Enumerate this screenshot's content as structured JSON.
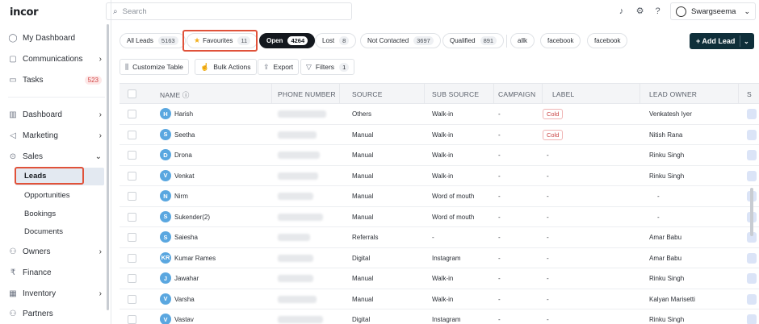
{
  "app": {
    "logo": "incor"
  },
  "search": {
    "placeholder": "Search"
  },
  "user": {
    "name": "Swargseema"
  },
  "sidebar": {
    "items": [
      {
        "label": "My Dashboard",
        "icon": "user-icon"
      },
      {
        "label": "Communications",
        "icon": "chat-icon"
      },
      {
        "label": "Tasks",
        "icon": "calendar-icon",
        "badge": "523"
      },
      {
        "label": "Dashboard",
        "icon": "bar-chart-icon"
      },
      {
        "label": "Marketing",
        "icon": "megaphone-icon"
      },
      {
        "label": "Sales",
        "icon": "dollar-icon"
      },
      {
        "label": "Owners",
        "icon": "people-icon"
      },
      {
        "label": "Finance",
        "icon": "rupee-icon"
      },
      {
        "label": "Inventory",
        "icon": "building-icon"
      },
      {
        "label": "Partners",
        "icon": "handshake-icon"
      }
    ],
    "sales_sub": [
      "Leads",
      "Opportunities",
      "Bookings",
      "Documents"
    ]
  },
  "chips": [
    {
      "label": "All Leads",
      "count": "5163"
    },
    {
      "label": "Favourites",
      "count": "11"
    },
    {
      "label": "Open",
      "count": "4264"
    },
    {
      "label": "Lost",
      "count": "8"
    },
    {
      "label": "Not Contacted",
      "count": "3697"
    },
    {
      "label": "Qualified",
      "count": "891"
    },
    {
      "label": "allk"
    },
    {
      "label": "facebook"
    },
    {
      "label": "facebook"
    }
  ],
  "add_lead": "+ Add Lead",
  "toolbar": {
    "customize": "Customize Table",
    "bulk": "Bulk Actions",
    "export": "Export",
    "filters": "Filters",
    "filters_count": "1"
  },
  "table": {
    "columns": [
      "NAME",
      "PHONE NUMBER",
      "SOURCE",
      "SUB SOURCE",
      "CAMPAIGN",
      "LABEL",
      "LEAD OWNER",
      "S"
    ],
    "rows": [
      {
        "initial": "H",
        "name": "Harish",
        "source": "Others",
        "sub_source": "Walk-in",
        "campaign": "-",
        "label": "Cold",
        "owner": "Venkatesh Iyer"
      },
      {
        "initial": "S",
        "name": "Seetha",
        "source": "Manual",
        "sub_source": "Walk-in",
        "campaign": "-",
        "label": "Cold",
        "owner": "Nitish Rana"
      },
      {
        "initial": "D",
        "name": "Drona",
        "source": "Manual",
        "sub_source": "Walk-in",
        "campaign": "-",
        "label": "-",
        "owner": "Rinku Singh"
      },
      {
        "initial": "V",
        "name": "Venkat",
        "source": "Manual",
        "sub_source": "Walk-in",
        "campaign": "-",
        "label": "-",
        "owner": "Rinku Singh"
      },
      {
        "initial": "N",
        "name": "Nirm",
        "source": "Manual",
        "sub_source": "Word of mouth",
        "campaign": "-",
        "label": "-",
        "owner": "-"
      },
      {
        "initial": "S",
        "name": "Sukender(2)",
        "source": "Manual",
        "sub_source": "Word of mouth",
        "campaign": "-",
        "label": "-",
        "owner": "-"
      },
      {
        "initial": "S",
        "name": "Saiesha",
        "source": "Referrals",
        "sub_source": "-",
        "campaign": "-",
        "label": "-",
        "owner": "Amar Babu"
      },
      {
        "initial": "KR",
        "name": "Kumar Rames",
        "source": "Digital",
        "sub_source": "Instagram",
        "campaign": "-",
        "label": "-",
        "owner": "Amar Babu"
      },
      {
        "initial": "J",
        "name": "Jawahar",
        "source": "Manual",
        "sub_source": "Walk-in",
        "campaign": "-",
        "label": "-",
        "owner": "Rinku Singh"
      },
      {
        "initial": "V",
        "name": "Varsha",
        "source": "Manual",
        "sub_source": "Walk-in",
        "campaign": "-",
        "label": "-",
        "owner": "Kalyan Marisetti"
      },
      {
        "initial": "V",
        "name": "Vastav",
        "source": "Digital",
        "sub_source": "Instagram",
        "campaign": "-",
        "label": "-",
        "owner": "Rinku Singh"
      }
    ]
  }
}
